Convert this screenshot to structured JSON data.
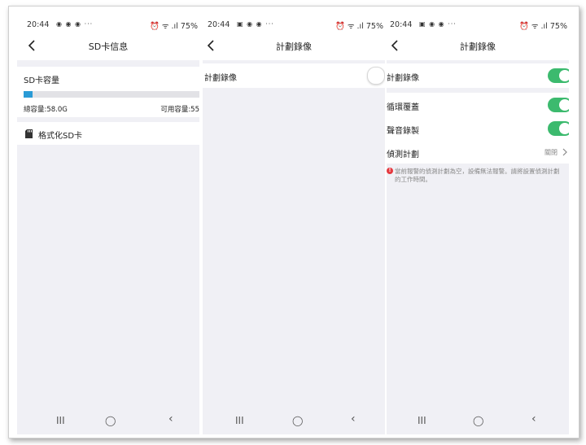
{
  "status": {
    "time": "20:44",
    "battery_left": "75%",
    "battery_mid": "75%",
    "battery_right": "75%"
  },
  "panel1": {
    "title": "SD卡信息",
    "capacity_label": "SD卡容量",
    "used_fraction": 0.05,
    "total_label": "總容量:58.0G",
    "available_label": "可用容量:55",
    "format_label": "格式化SD卡"
  },
  "panel2": {
    "title": "計劃錄像",
    "schedule_label": "計劃錄像",
    "schedule_on": false
  },
  "panel3": {
    "title": "計劃錄像",
    "schedule_label": "計劃錄像",
    "loop_label": "循環覆蓋",
    "audio_label": "聲音錄製",
    "detect_plan_label": "偵測計劃",
    "detect_plan_value": "關閉",
    "warning_line1": "當前報警的偵測計劃為空，設備無法報警。請將設置偵測計劃",
    "warning_line2": "的工作時間。"
  },
  "nav": {
    "recent": "III",
    "home": "◯",
    "back": "‹"
  },
  "colors": {
    "accent_blue": "#2a9bd6",
    "toggle_green": "#3cba6e",
    "warning_red": "#e5393f"
  }
}
